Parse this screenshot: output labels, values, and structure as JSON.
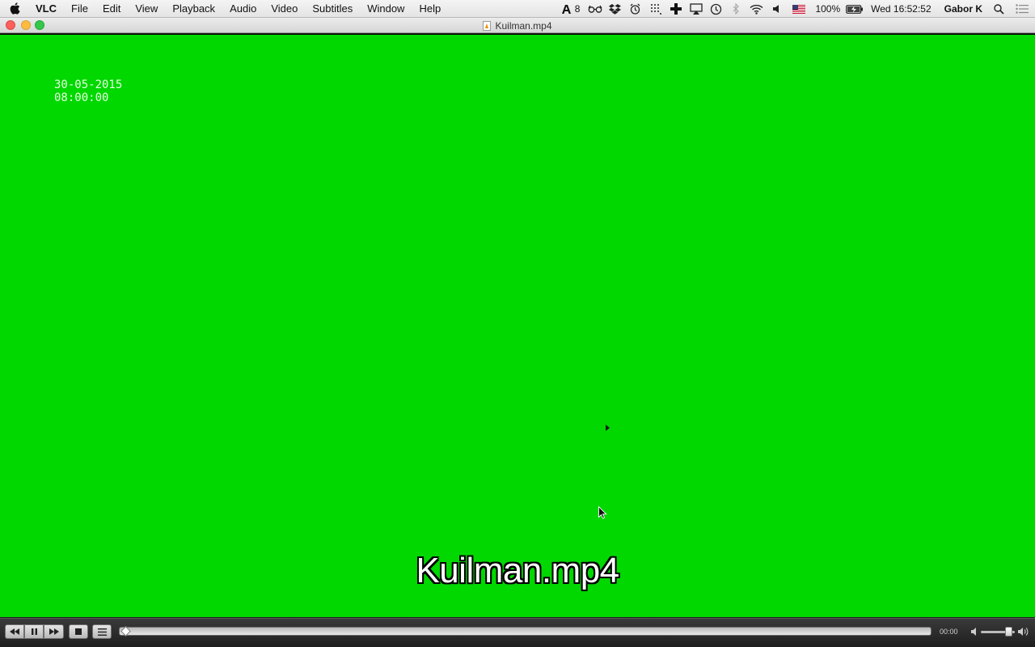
{
  "menubar": {
    "apple_icon": "apple-icon",
    "app_name": "VLC",
    "items": [
      "File",
      "Edit",
      "View",
      "Playback",
      "Audio",
      "Video",
      "Subtitles",
      "Window",
      "Help"
    ],
    "status": {
      "adobe_count": "8",
      "battery": "100%",
      "clock": "Wed 16:52:52",
      "user": "Gabor K"
    }
  },
  "window": {
    "title": "Kuilman.mp4"
  },
  "video": {
    "background": "#00d800",
    "timestamp_date": "30-05-2015",
    "timestamp_time": "08:00:00",
    "osd_title": "Kuilman.mp4"
  },
  "controls": {
    "time": "00:00",
    "seek_progress": 0,
    "volume_level": 0.82
  }
}
